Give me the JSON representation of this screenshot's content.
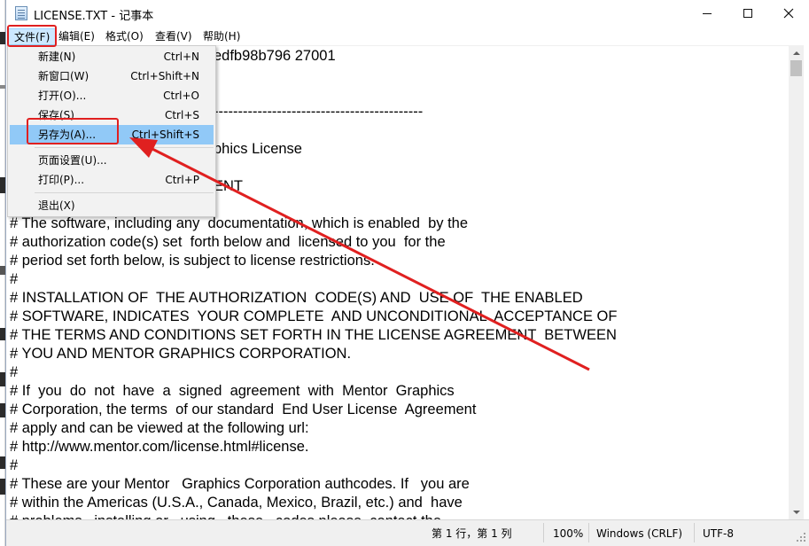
{
  "window": {
    "title": "LICENSE.TXT - 记事本"
  },
  "menubar": {
    "file": "文件(F)",
    "edit": "编辑(E)",
    "format": "格式(O)",
    "view": "查看(V)",
    "help": "帮助(H)"
  },
  "file_menu": {
    "items": [
      {
        "label": "新建(N)",
        "shortcut": "Ctrl+N"
      },
      {
        "label": "新窗口(W)",
        "shortcut": "Ctrl+Shift+N"
      },
      {
        "label": "打开(O)...",
        "shortcut": "Ctrl+O"
      },
      {
        "label": "保存(S)",
        "shortcut": "Ctrl+S"
      },
      {
        "label": "另存为(A)...",
        "shortcut": "Ctrl+Shift+S"
      },
      {
        "label": "页面设置(U)...",
        "shortcut": ""
      },
      {
        "label": "打印(P)...",
        "shortcut": "Ctrl+P"
      },
      {
        "label": "退出(X)",
        "shortcut": ""
      }
    ],
    "highlighted_index": 4
  },
  "editor": {
    "visible_fragments": {
      "line1": "edfb98b796 27001",
      "line3": "-------------------------------------------",
      "line5": "phics License",
      "line7": "ENT"
    },
    "lines": [
      "# The software, including any  documentation, which is enabled  by the",
      "# authorization code(s) set  forth below and  licensed to you  for the",
      "# period set forth below, is subject to license restrictions.",
      "#",
      "# INSTALLATION OF  THE AUTHORIZATION  CODE(S) AND  USE OF  THE ENABLED",
      "# SOFTWARE, INDICATES  YOUR COMPLETE  AND UNCONDITIONAL  ACCEPTANCE OF",
      "# THE TERMS AND CONDITIONS SET FORTH IN THE LICENSE AGREEMENT  BETWEEN",
      "# YOU AND MENTOR GRAPHICS CORPORATION.",
      "#",
      "# If  you  do  not  have  a  signed  agreement  with  Mentor  Graphics",
      "# Corporation, the terms  of our standard  End User License  Agreement",
      "# apply and can be viewed at the following url:",
      "# http://www.mentor.com/license.html#license.",
      "#",
      "# These are your Mentor   Graphics Corporation authcodes. If   you are",
      "# within the Americas (U.S.A., Canada, Mexico, Brazil, etc.) and  have",
      "# problems   installing or   using   these   codes please  contact the"
    ]
  },
  "statusbar": {
    "position": "第 1 行，第 1 列",
    "zoom": "100%",
    "line_ending": "Windows (CRLF)",
    "encoding": "UTF-8"
  },
  "colors": {
    "annotation_red": "#e02020",
    "menu_highlight": "#91c9f7",
    "menu_file_active": "#cce8ff"
  }
}
